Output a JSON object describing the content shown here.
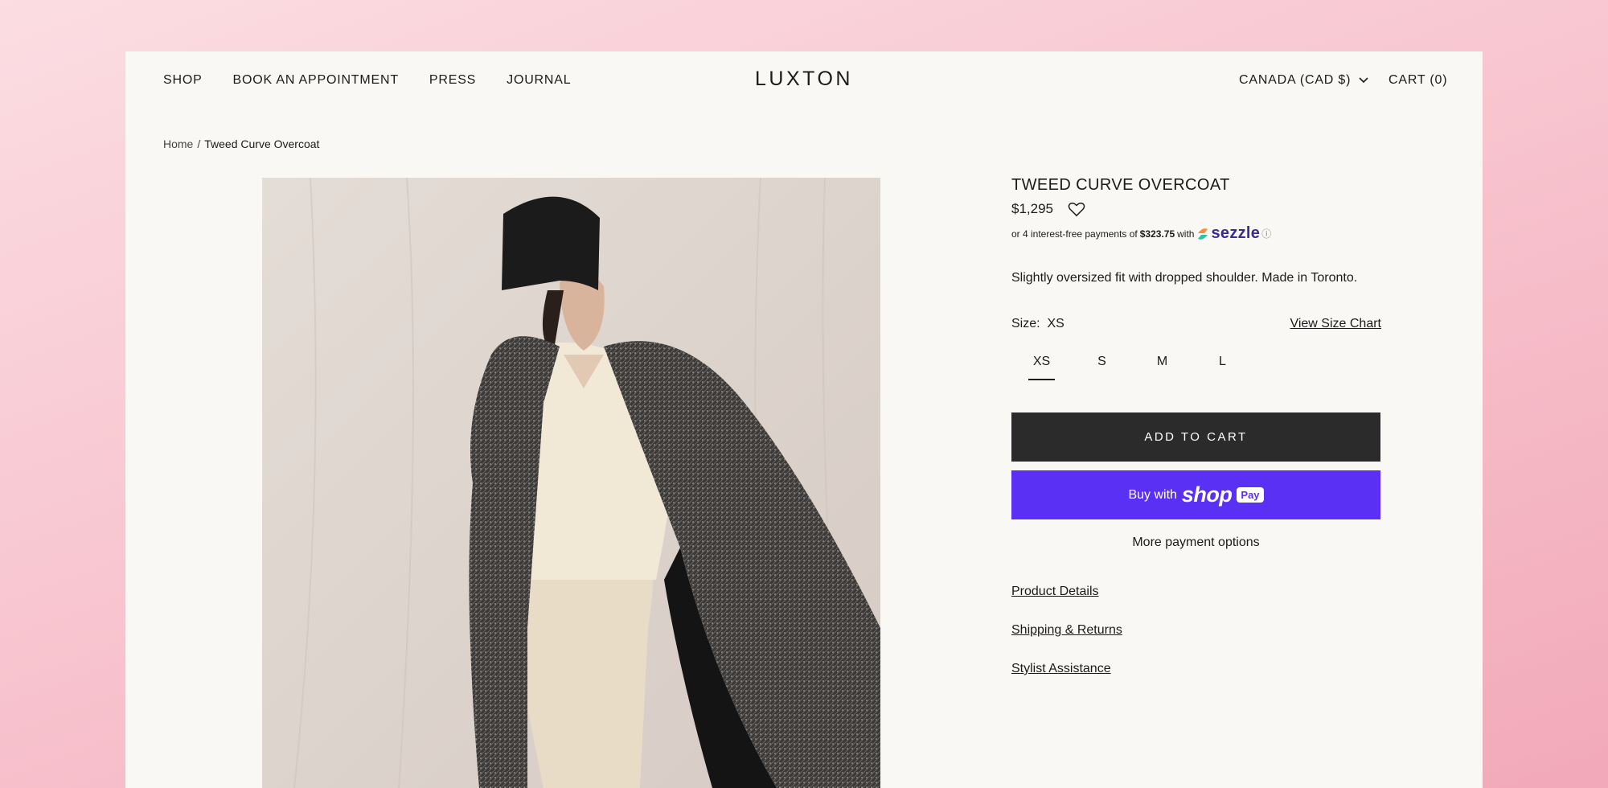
{
  "header": {
    "nav": [
      "SHOP",
      "BOOK AN APPOINTMENT",
      "PRESS",
      "JOURNAL"
    ],
    "logo": "LUXTON",
    "country": "CANADA (CAD $)",
    "cart": "CART (0)"
  },
  "breadcrumb": {
    "home": "Home",
    "separator": "/",
    "current": "Tweed Curve Overcoat"
  },
  "product": {
    "title": "TWEED CURVE OVERCOAT",
    "price": "$1,295",
    "sezzle": {
      "prefix": "or 4 interest-free payments of",
      "amount": "$323.75",
      "with": "with",
      "brand": "sezzle",
      "info": "ⓘ"
    },
    "description": "Slightly oversized fit with dropped shoulder. Made in Toronto.",
    "size_label": "Size:",
    "selected_size": "XS",
    "size_chart": "View Size Chart",
    "sizes": [
      "XS",
      "S",
      "M",
      "L"
    ],
    "add_to_cart": "ADD TO CART",
    "shop_pay": {
      "buy_with": "Buy with",
      "shop": "shop",
      "pay": "Pay"
    },
    "more_payment": "More payment options",
    "links": [
      "Product Details",
      "Shipping & Returns",
      "Stylist Assistance"
    ]
  },
  "colors": {
    "accent_button": "#2b2b2b",
    "shop_pay": "#5a31f4",
    "page_bg": "#faf8f4"
  }
}
